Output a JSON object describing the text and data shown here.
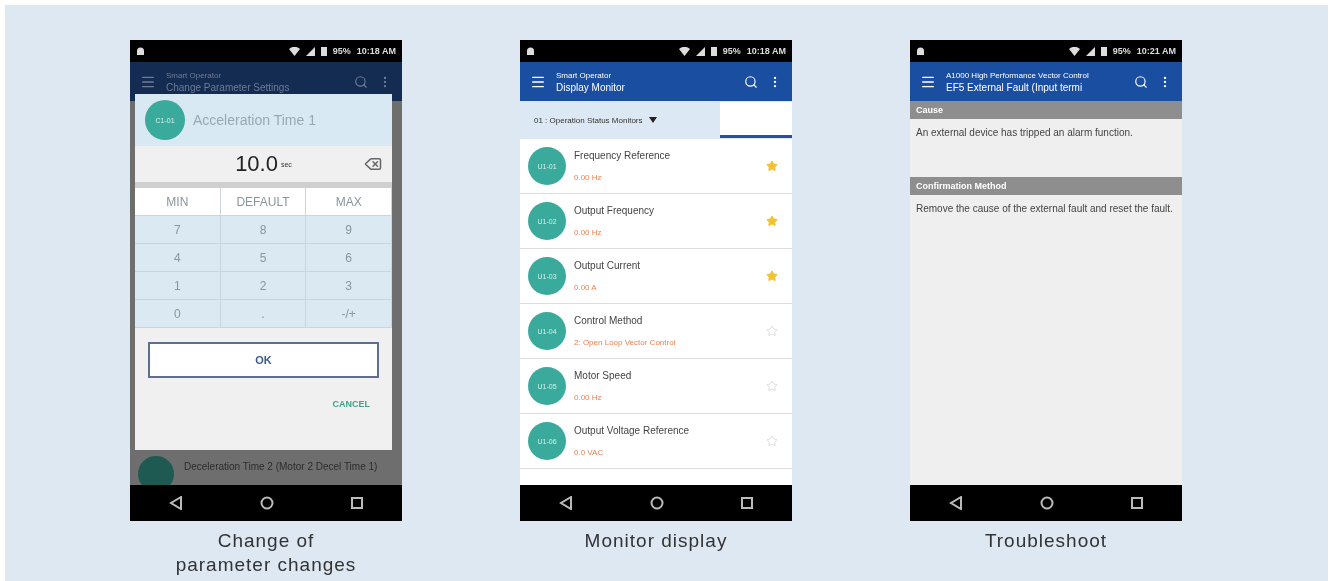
{
  "phones": [
    {
      "kind": "parameter",
      "status_time": "10:18 AM",
      "battery": "95%",
      "app_bar": {
        "title": "Smart Operator",
        "subtitle": "Change Parameter Settings"
      },
      "background_item": {
        "title": "Deceleration Time 2 (Motor 2 Decel Time 1)"
      },
      "dialog": {
        "badge": "C1-01",
        "title": "Acceleration Time 1",
        "value": "10.0",
        "unit": "sec",
        "presets": [
          "MIN",
          "DEFAULT",
          "MAX"
        ],
        "keys": [
          "7",
          "8",
          "9",
          "4",
          "5",
          "6",
          "1",
          "2",
          "3",
          "0",
          ".",
          "-/+"
        ],
        "ok": "OK",
        "cancel": "CANCEL"
      },
      "caption": "Change of\nparameter changes"
    },
    {
      "kind": "monitor",
      "status_time": "10:18 AM",
      "battery": "95%",
      "app_bar": {
        "title": "Smart Operator",
        "subtitle": "Display Monitor"
      },
      "dropdown": "01 : Operation Status Monitors",
      "items": [
        {
          "badge": "U1-01",
          "title": "Frequency Reference",
          "value": "0.00 Hz",
          "starred": true
        },
        {
          "badge": "U1-02",
          "title": "Output Frequency",
          "value": "0.00 Hz",
          "starred": true
        },
        {
          "badge": "U1-03",
          "title": "Output Current",
          "value": "0.00 A",
          "starred": true
        },
        {
          "badge": "U1-04",
          "title": "Control Method",
          "value": "2: Open Loop Vector Control",
          "starred": false
        },
        {
          "badge": "U1-05",
          "title": "Motor Speed",
          "value": "0.00 Hz",
          "starred": false
        },
        {
          "badge": "U1-06",
          "title": "Output Voltage Reference",
          "value": "0.0 VAC",
          "starred": false
        }
      ],
      "caption": "Monitor display"
    },
    {
      "kind": "troubleshoot",
      "status_time": "10:21 AM",
      "battery": "95%",
      "app_bar": {
        "title": "A1000 High Performance Vector Control",
        "subtitle": "EF5 External Fault (Input termi"
      },
      "sections": [
        {
          "heading": "Cause",
          "text": "An external device has tripped an alarm function."
        },
        {
          "heading": "Confirmation Method",
          "text": "Remove the cause of the external fault and reset the fault."
        }
      ],
      "caption": "Troubleshoot"
    }
  ]
}
